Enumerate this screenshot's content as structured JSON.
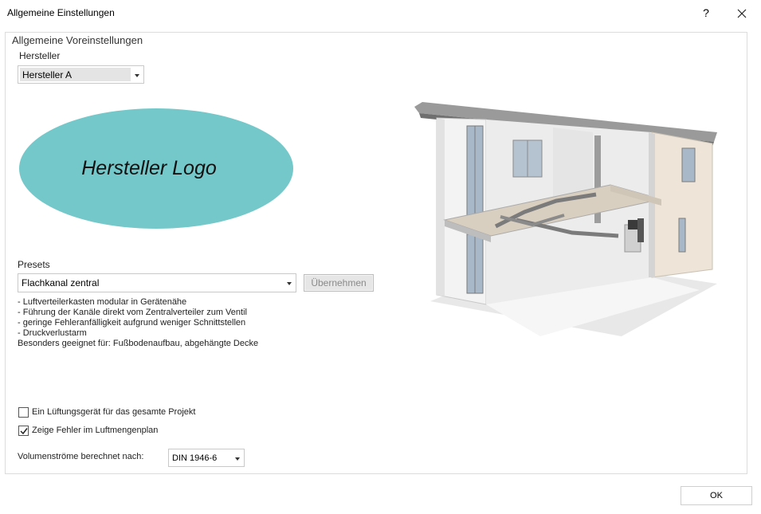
{
  "window": {
    "title": "Allgemeine Einstellungen",
    "help_label": "?"
  },
  "group": {
    "title": "Allgemeine Voreinstellungen"
  },
  "hersteller": {
    "label": "Hersteller",
    "selected": "Hersteller A",
    "logo_text": "Hersteller Logo",
    "logo_color": "#74c8c9"
  },
  "presets": {
    "label": "Presets",
    "selected": "Flachkanal zentral",
    "apply_label": "Übernehmen",
    "description": [
      "- Luftverteilerkasten modular in Gerätenähe",
      "- Führung der Kanäle direkt vom Zentralverteiler zum Ventil",
      "- geringe Fehleranfälligkeit aufgrund weniger Schnittstellen",
      "- Druckverlustarm",
      "Besonders geeignet für: Fußbodenaufbau, abgehängte Decke"
    ]
  },
  "options": {
    "single_device": {
      "label": "Ein Lüftungsgerät für das gesamte Projekt",
      "checked": false
    },
    "show_errors": {
      "label": "Zeige Fehler im Luftmengenplan",
      "checked": true
    }
  },
  "volumenstroeme": {
    "label": "Volumenströme berechnet nach:",
    "selected": "DIN 1946-6"
  },
  "footer": {
    "ok_label": "OK"
  }
}
